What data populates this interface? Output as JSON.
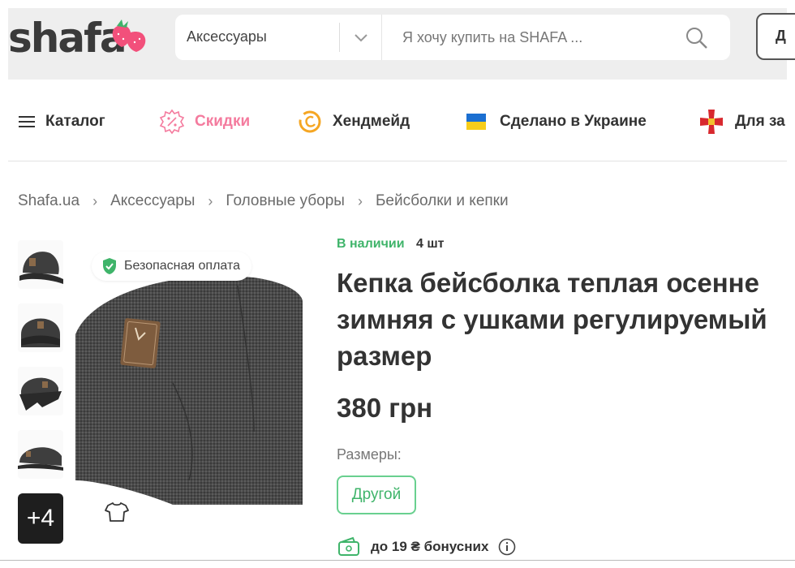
{
  "header": {
    "logo_text": "shafa",
    "category_select": "Аксессуары",
    "search_placeholder": "Я хочу купить на SHAFA ...",
    "login_label": "Д"
  },
  "nav": {
    "catalog": "Каталог",
    "sale": "Скидки",
    "handmade": "Хендмейд",
    "made_in_ukraine": "Сделано в Украине",
    "for_defenders": "Для за"
  },
  "breadcrumb": [
    "Shafa.ua",
    "Аксессуары",
    "Головные уборы",
    "Бейсболки и кепки"
  ],
  "gallery": {
    "more_label": "+4",
    "secure_payment": "Безопасная оплата"
  },
  "product": {
    "stock_status": "В наличии",
    "stock_qty": "4 шт",
    "title_lines": [
      "Кепка бейсболка теплая осенне",
      "зимняя с ушками регулируемый",
      "размер"
    ],
    "price": "380 грн",
    "sizes_label": "Размеры:",
    "size_selected": "Другой",
    "bonus_text": "до 19 ₴ бонусних"
  },
  "colors": {
    "accent_green": "#3fb46a",
    "sale_pink": "#f47b9e",
    "header_bg": "#eeeeee"
  }
}
